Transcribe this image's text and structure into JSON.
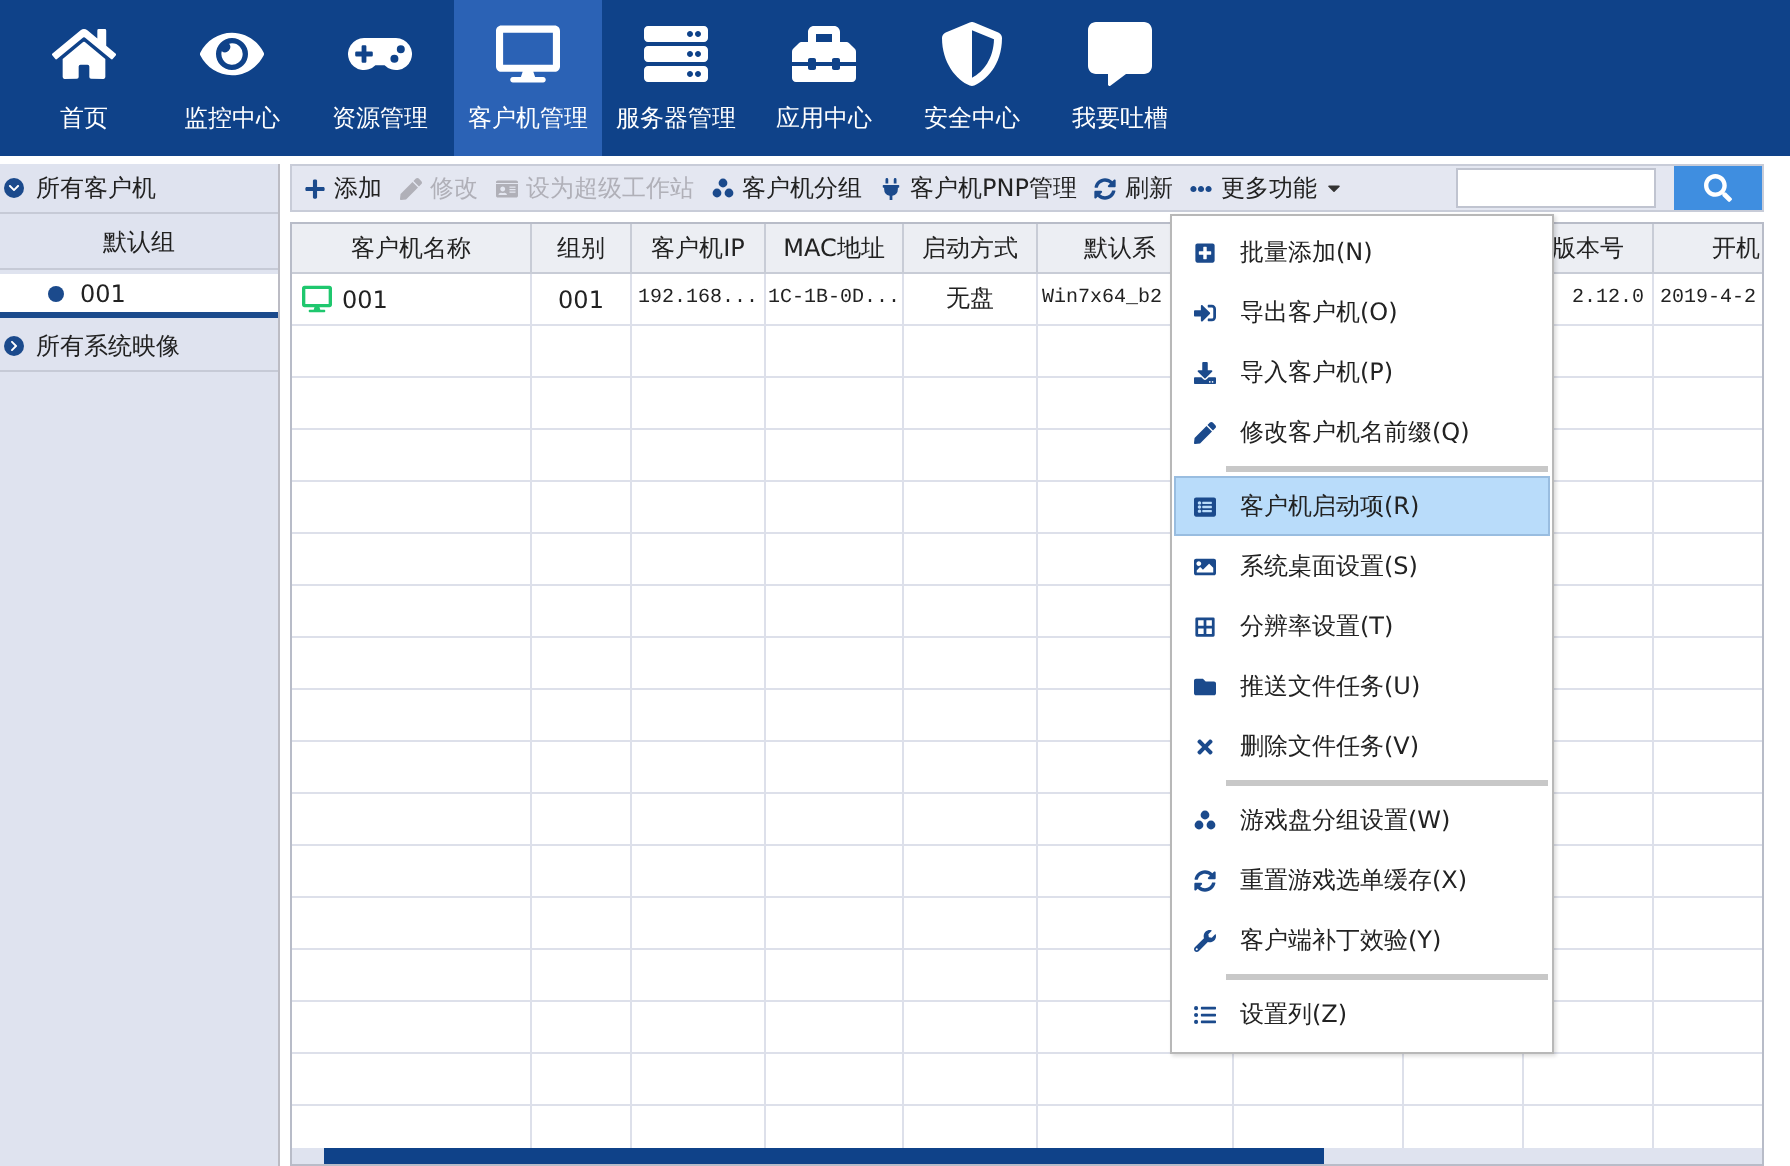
{
  "nav": [
    {
      "label": "首页",
      "selected": false
    },
    {
      "label": "监控中心",
      "selected": false
    },
    {
      "label": "资源管理",
      "selected": false
    },
    {
      "label": "客户机管理",
      "selected": true
    },
    {
      "label": "服务器管理",
      "selected": false
    },
    {
      "label": "应用中心",
      "selected": false
    },
    {
      "label": "安全中心",
      "selected": false
    },
    {
      "label": "我要吐槽",
      "selected": false
    }
  ],
  "sidebar": {
    "tree": [
      {
        "label": "所有客户机",
        "expanded": true,
        "children": [
          {
            "label": "默认组",
            "selected": false,
            "children": [
              {
                "label": "001",
                "selected": true
              }
            ]
          }
        ]
      },
      {
        "label": "所有系统映像",
        "expanded": false
      }
    ]
  },
  "toolbar": {
    "buttons": [
      {
        "label": "添加",
        "disabled": false,
        "kind": "button"
      },
      {
        "label": "修改",
        "disabled": true,
        "kind": "button"
      },
      {
        "label": "设为超级工作站",
        "disabled": true,
        "kind": "button"
      },
      {
        "label": "客户机分组",
        "disabled": false,
        "kind": "button"
      },
      {
        "label": "客户机PNP管理",
        "disabled": false,
        "kind": "button"
      },
      {
        "label": "刷新",
        "disabled": false,
        "kind": "button"
      },
      {
        "label": "更多功能",
        "disabled": false,
        "kind": "dropdown"
      }
    ]
  },
  "table": {
    "columns": [
      {
        "label": "客户机名称"
      },
      {
        "label": "组别"
      },
      {
        "label": "客户机IP"
      },
      {
        "label": "MAC地址"
      },
      {
        "label": "启动方式"
      },
      {
        "label": "默认系"
      },
      {},
      {},
      {
        "label": "版本号"
      },
      {
        "label": "开机"
      }
    ],
    "rows": [
      {
        "cells": [
          "001",
          "001",
          "192.168...",
          "1C-1B-0D...",
          "无盘",
          "Win7x64_b2",
          null,
          null,
          "2.12.0",
          "2019-4-2"
        ]
      }
    ]
  },
  "menu": {
    "sections": [
      {
        "items": [
          {
            "label": "批量添加(N)",
            "selected": false
          },
          {
            "label": "导出客户机(O)",
            "selected": false
          },
          {
            "label": "导入客户机(P)",
            "selected": false
          },
          {
            "label": "修改客户机名前缀(Q)",
            "selected": false
          }
        ]
      },
      {
        "items": [
          {
            "label": "客户机启动项(R)",
            "selected": true
          },
          {
            "label": "系统桌面设置(S)",
            "selected": false
          },
          {
            "label": "分辨率设置(T)",
            "selected": false
          },
          {
            "label": "推送文件任务(U)",
            "selected": false
          },
          {
            "label": "删除文件任务(V)",
            "selected": false
          }
        ]
      },
      {
        "items": [
          {
            "label": "游戏盘分组设置(W)",
            "selected": false
          },
          {
            "label": "重置游戏选单缓存(X)",
            "selected": false
          },
          {
            "label": "客户端补丁效验(Y)",
            "selected": false
          }
        ]
      },
      {
        "items": [
          {
            "label": "设置列(Z)",
            "selected": false
          }
        ]
      }
    ]
  }
}
